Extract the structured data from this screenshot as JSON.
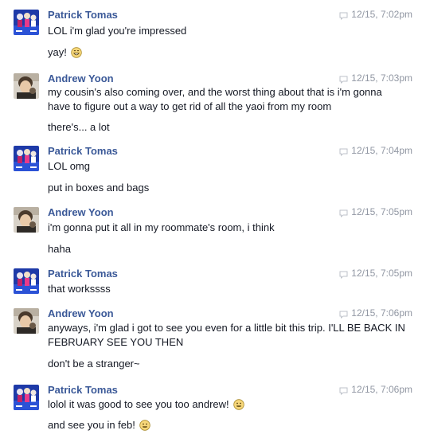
{
  "messages": [
    {
      "sender": "Patrick Tomas",
      "avatar_icon": "patrick-avatar",
      "timestamp": "12/15, 7:02pm",
      "lines": [
        {
          "text": "LOL i'm glad you're impressed"
        },
        {
          "text": "yay!",
          "emoji": "grin-emoji"
        }
      ]
    },
    {
      "sender": "Andrew Yoon",
      "avatar_icon": "andrew-avatar",
      "timestamp": "12/15, 7:03pm",
      "lines": [
        {
          "text": "my cousin's also coming over, and the worst thing about that is i'm gonna have to figure out a way to get rid of all the yaoi from my room"
        },
        {
          "text": "there's... a lot"
        }
      ]
    },
    {
      "sender": "Patrick Tomas",
      "avatar_icon": "patrick-avatar",
      "timestamp": "12/15, 7:04pm",
      "lines": [
        {
          "text": "LOL omg"
        },
        {
          "text": "put in boxes and bags"
        }
      ]
    },
    {
      "sender": "Andrew Yoon",
      "avatar_icon": "andrew-avatar",
      "timestamp": "12/15, 7:05pm",
      "lines": [
        {
          "text": "i'm gonna put it all in my roommate's room, i think"
        },
        {
          "text": "haha"
        }
      ]
    },
    {
      "sender": "Patrick Tomas",
      "avatar_icon": "patrick-avatar",
      "timestamp": "12/15, 7:05pm",
      "lines": [
        {
          "text": "that workssss"
        }
      ]
    },
    {
      "sender": "Andrew Yoon",
      "avatar_icon": "andrew-avatar",
      "timestamp": "12/15, 7:06pm",
      "lines": [
        {
          "text": "anyways, i'm glad i got to see you even for a little bit this trip. I'LL BE BACK IN FEBRUARY SEE YOU THEN"
        },
        {
          "text": "don't be a stranger~"
        }
      ]
    },
    {
      "sender": "Patrick Tomas",
      "avatar_icon": "patrick-avatar",
      "timestamp": "12/15, 7:06pm",
      "lines": [
        {
          "text": "lolol it was good to see you too andrew!",
          "emoji": "smile-emoji"
        },
        {
          "text": "and see you in feb!",
          "emoji": "smile-emoji"
        }
      ]
    }
  ],
  "colors": {
    "sender": "#3b5998",
    "text": "#141823",
    "timestamp": "#9197a3",
    "emoji_fill": "#f7d77a",
    "emoji_stroke": "#a88a2a"
  }
}
